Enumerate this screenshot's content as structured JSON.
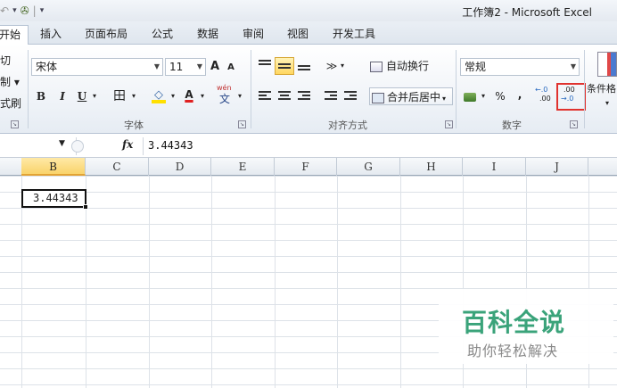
{
  "window": {
    "title": "工作簿2 - Microsoft Excel"
  },
  "qat": {
    "undo_symbol": "↶",
    "dropdown_symbol": "▾",
    "fill_symbol": "✇"
  },
  "tabs": [
    {
      "label": "开始",
      "active": true
    },
    {
      "label": "插入"
    },
    {
      "label": "页面布局"
    },
    {
      "label": "公式"
    },
    {
      "label": "数据"
    },
    {
      "label": "审阅"
    },
    {
      "label": "视图"
    },
    {
      "label": "开发工具"
    }
  ],
  "clipboard": {
    "cut": "切",
    "copy": "制 ▾",
    "format_painter": "式刷"
  },
  "font_group": {
    "font_name": "宋体",
    "font_size": "11",
    "grow": "A",
    "shrink": "A",
    "bold": "B",
    "italic": "I",
    "underline": "U",
    "border": "田",
    "fill": "◇",
    "font_color": "A",
    "phonetic_top": "wén",
    "phonetic_bottom": "文",
    "label": "字体"
  },
  "alignment_group": {
    "orientation": "≫",
    "wrap_text": "自动换行",
    "merge_center": "合并后居中",
    "label": "对齐方式"
  },
  "number_group": {
    "format": "常规",
    "percent": "%",
    "comma": ",",
    "increase_decimal_top": "←.0",
    "increase_decimal_bottom": ".00",
    "decrease_decimal_top": ".00",
    "decrease_decimal_bottom": "→.0",
    "label": "数字"
  },
  "styles_group": {
    "conditional_format": "条件格"
  },
  "formula_bar": {
    "fx": "fx",
    "content": "3.44343"
  },
  "columns": [
    "B",
    "C",
    "D",
    "E",
    "F",
    "G",
    "H",
    "I",
    "J"
  ],
  "active_cell": {
    "value": "3.44343"
  },
  "watermark": {
    "title": "百科全说",
    "subtitle": "助你轻松解决"
  },
  "colors": {
    "accent_highlight": "#ffd760",
    "selection_border": "#e0322e",
    "watermark_green": "#3aa37a"
  }
}
